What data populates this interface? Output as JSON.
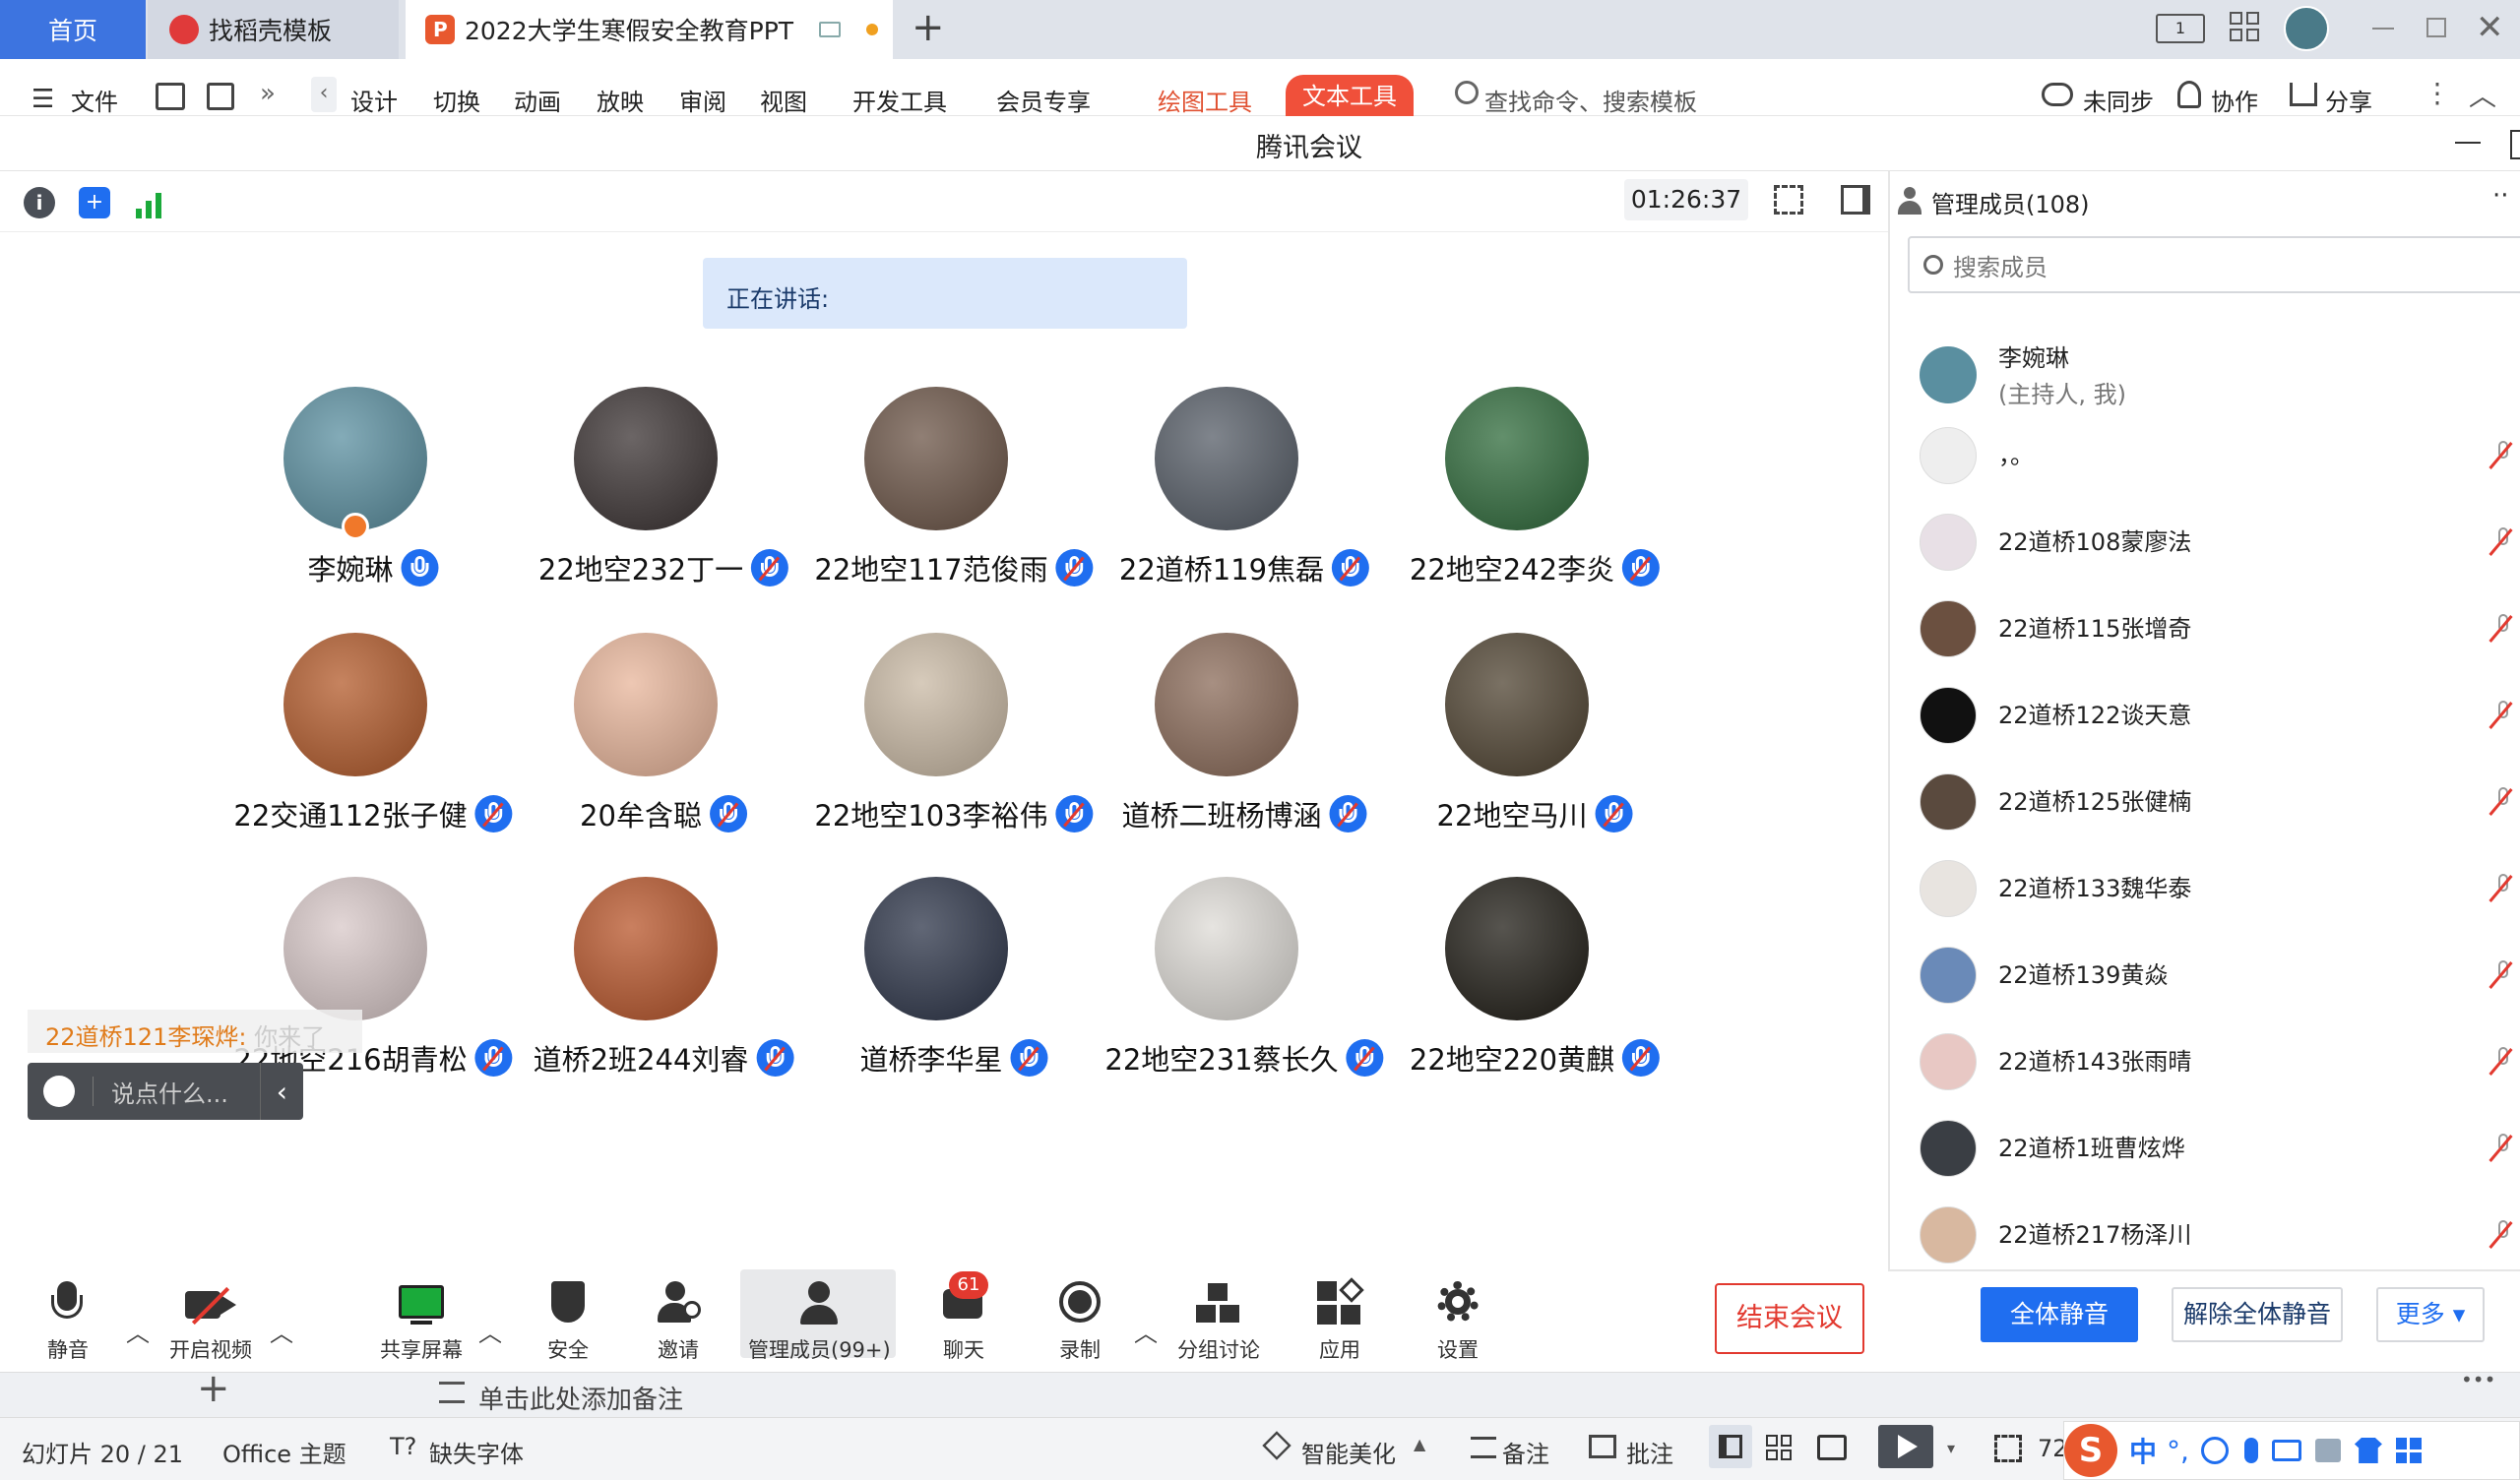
{
  "tabs": {
    "home": "首页",
    "doc": "找稻壳模板",
    "ppt": "2022大学生寒假安全教育PPT"
  },
  "menu": {
    "file": "文件",
    "items": [
      "设计",
      "切换",
      "动画",
      "放映",
      "审阅",
      "视图",
      "开发工具",
      "会员专享"
    ],
    "draw_tool": "绘图工具",
    "text_tool": "文本工具",
    "search": "查找命令、搜索模板",
    "sync": "未同步",
    "collab": "协作",
    "share": "分享"
  },
  "meeting": {
    "title": "腾讯会议",
    "timer": "01:26:37",
    "speaking": "正在讲话:",
    "participants": [
      {
        "name": "李婉琳",
        "color": "#5a8fa0"
      },
      {
        "name": "22地空232丁一",
        "color": "#3a3232"
      },
      {
        "name": "22地空117范俊雨",
        "color": "#6b5446"
      },
      {
        "name": "22道桥119焦磊",
        "color": "#555c66"
      },
      {
        "name": "22地空242李炎",
        "color": "#2e6a3a"
      },
      {
        "name": "22交通112张子健",
        "color": "#b35a2a"
      },
      {
        "name": "20牟含聪",
        "color": "#e8b59a"
      },
      {
        "name": "22地空103李裕伟",
        "color": "#c9b9a4"
      },
      {
        "name": "道桥二班杨博涵",
        "color": "#8a6a58"
      },
      {
        "name": "22地空马川",
        "color": "#4e4230"
      },
      {
        "name": "22地空216胡青松",
        "color": "#d8c8c8"
      },
      {
        "name": "道桥2班244刘睿",
        "color": "#b8552a"
      },
      {
        "name": "道桥李华星",
        "color": "#2c3448"
      },
      {
        "name": "22地空231蔡长久",
        "color": "#dedbd6"
      },
      {
        "name": "22地空220黄麒",
        "color": "#1e1b14"
      }
    ],
    "chat_preview_name": "22道桥121李琛烨:",
    "chat_preview_text": "你来了",
    "chat_placeholder": "说点什么...",
    "controls": {
      "mute": "静音",
      "video": "开启视频",
      "share": "共享屏幕",
      "security": "安全",
      "invite": "邀请",
      "members": "管理成员(99+)",
      "chat": "聊天",
      "chat_badge": "61",
      "record": "录制",
      "breakout": "分组讨论",
      "apps": "应用",
      "settings": "设置",
      "end": "结束会议"
    }
  },
  "panel": {
    "title": "管理成员(108)",
    "search_placeholder": "搜索成员",
    "host_name": "李婉琳",
    "host_sub": "(主持人, 我)",
    "members": [
      {
        "name": "，。",
        "color": "#eeeeee"
      },
      {
        "name": "22道桥108蒙廖法",
        "color": "#e8e0e6"
      },
      {
        "name": "22道桥115张增奇",
        "color": "#6b5040"
      },
      {
        "name": "22道桥122谈天意",
        "color": "#111111"
      },
      {
        "name": "22道桥125张健楠",
        "color": "#5a4a3e"
      },
      {
        "name": "22道桥133魏华泰",
        "color": "#e8e4e0"
      },
      {
        "name": "22道桥139黄焱",
        "color": "#6a8ab8"
      },
      {
        "name": "22道桥143张雨晴",
        "color": "#e8c8c4"
      },
      {
        "name": "22道桥1班曹炫烨",
        "color": "#3a3e44"
      },
      {
        "name": "22道桥217杨泽川",
        "color": "#d8b8a0"
      }
    ],
    "mute_all": "全体静音",
    "unmute_all": "解除全体静音",
    "more": "更多 ▾"
  },
  "notes": {
    "placeholder": "单击此处添加备注"
  },
  "status": {
    "slide": "幻灯片 20 / 21",
    "theme": "Office 主题",
    "missing_font": "缺失字体",
    "beautify": "智能美化",
    "notes": "备注",
    "comments": "批注",
    "zoom": "72"
  }
}
